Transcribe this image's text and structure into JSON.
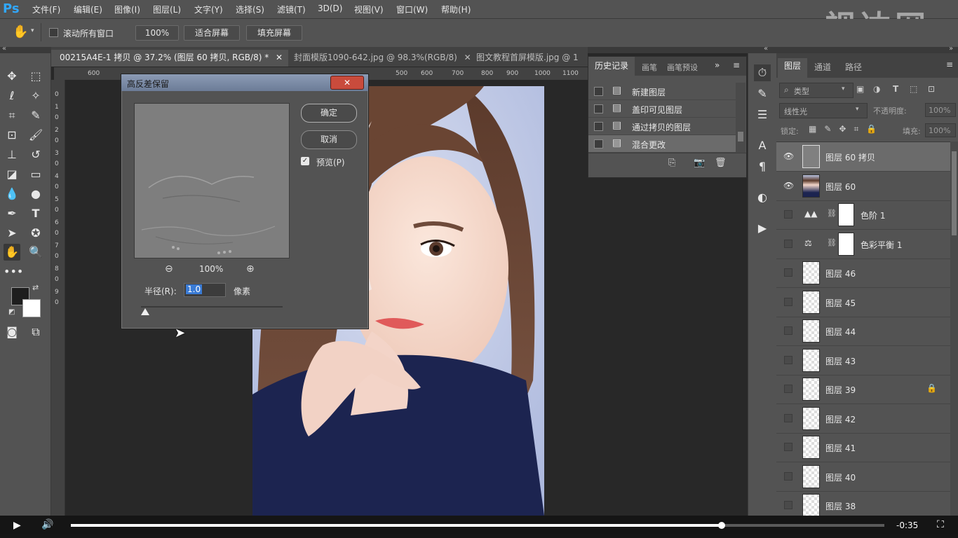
{
  "app": {
    "logo": "Ps"
  },
  "menu": [
    "文件(F)",
    "编辑(E)",
    "图像(I)",
    "图层(L)",
    "文字(Y)",
    "选择(S)",
    "滤镜(T)",
    "3D(D)",
    "视图(V)",
    "窗口(W)",
    "帮助(H)"
  ],
  "watermark": "视达网",
  "options_bar": {
    "scroll_all_label": "滚动所有窗口",
    "zoom_value": "100%",
    "fit_screen_label": "适合屏幕",
    "fill_screen_label": "填充屏幕"
  },
  "tabs": [
    {
      "label": "00215A4E-1 拷贝 @ 37.2% (图层 60 拷贝, RGB/8) *",
      "active": true
    },
    {
      "label": "封面模版1090-642.jpg @ 98.3%(RGB/8)",
      "active": false
    },
    {
      "label": "图文教程首屏模版.jpg @ 1",
      "active": false
    }
  ],
  "ruler": {
    "h_labels": [
      "600",
      "500",
      "600",
      "700",
      "800",
      "900",
      "1000",
      "1100"
    ],
    "v_labels": [
      "0",
      "1",
      "0",
      "2",
      "0",
      "3",
      "0",
      "4",
      "0",
      "5",
      "0",
      "6",
      "0",
      "7",
      "0",
      "8",
      "0",
      "9",
      "0"
    ]
  },
  "dialog": {
    "title": "高反差保留",
    "close_label": "✕",
    "ok_label": "确定",
    "cancel_label": "取消",
    "preview_label": "预览(P)",
    "preview_checked": true,
    "zoom_value": "100%",
    "radius_label": "半径(R):",
    "radius_value": "1.0",
    "radius_unit": "像素",
    "slider_level": 0.03
  },
  "history_panel": {
    "tabs": [
      "历史记录",
      "画笔",
      "画笔预设"
    ],
    "items": [
      "新建图层",
      "盖印可见图层",
      "通过拷贝的图层",
      "混合更改"
    ],
    "selected_index": 3
  },
  "layers_panel": {
    "tabs": [
      "图层",
      "通道",
      "路径"
    ],
    "filter_label": "类型",
    "blend_mode": "线性光",
    "opacity_label": "不透明度:",
    "opacity_value": "100%",
    "lock_label": "锁定:",
    "fill_label": "填充:",
    "fill_value": "100%",
    "layers": [
      {
        "name": "图层 60 拷贝",
        "visible": true,
        "selected": true,
        "kind": "gray"
      },
      {
        "name": "图层 60",
        "visible": true,
        "selected": false,
        "kind": "photo"
      },
      {
        "name": "色阶 1",
        "visible": false,
        "selected": false,
        "kind": "adjustment",
        "icon": "levels-icon"
      },
      {
        "name": "色彩平衡 1",
        "visible": false,
        "selected": false,
        "kind": "adjustment",
        "icon": "balance-icon"
      },
      {
        "name": "图层 46",
        "visible": false,
        "selected": false,
        "kind": "transparent"
      },
      {
        "name": "图层 45",
        "visible": false,
        "selected": false,
        "kind": "transparent"
      },
      {
        "name": "图层 44",
        "visible": false,
        "selected": false,
        "kind": "transparent"
      },
      {
        "name": "图层 43",
        "visible": false,
        "selected": false,
        "kind": "transparent"
      },
      {
        "name": "图层 39",
        "visible": false,
        "selected": false,
        "kind": "transparent",
        "locked": true
      },
      {
        "name": "图层 42",
        "visible": false,
        "selected": false,
        "kind": "transparent"
      },
      {
        "name": "图层 41",
        "visible": false,
        "selected": false,
        "kind": "transparent"
      },
      {
        "name": "图层 40",
        "visible": false,
        "selected": false,
        "kind": "transparent"
      },
      {
        "name": "图层 38",
        "visible": false,
        "selected": false,
        "kind": "transparent"
      }
    ]
  },
  "video": {
    "time_remaining": "-0:35",
    "progress": 0.8
  },
  "colors": {
    "accent": "#31a8ff",
    "panel": "#535353",
    "selected_row": "#6b6b6b"
  }
}
